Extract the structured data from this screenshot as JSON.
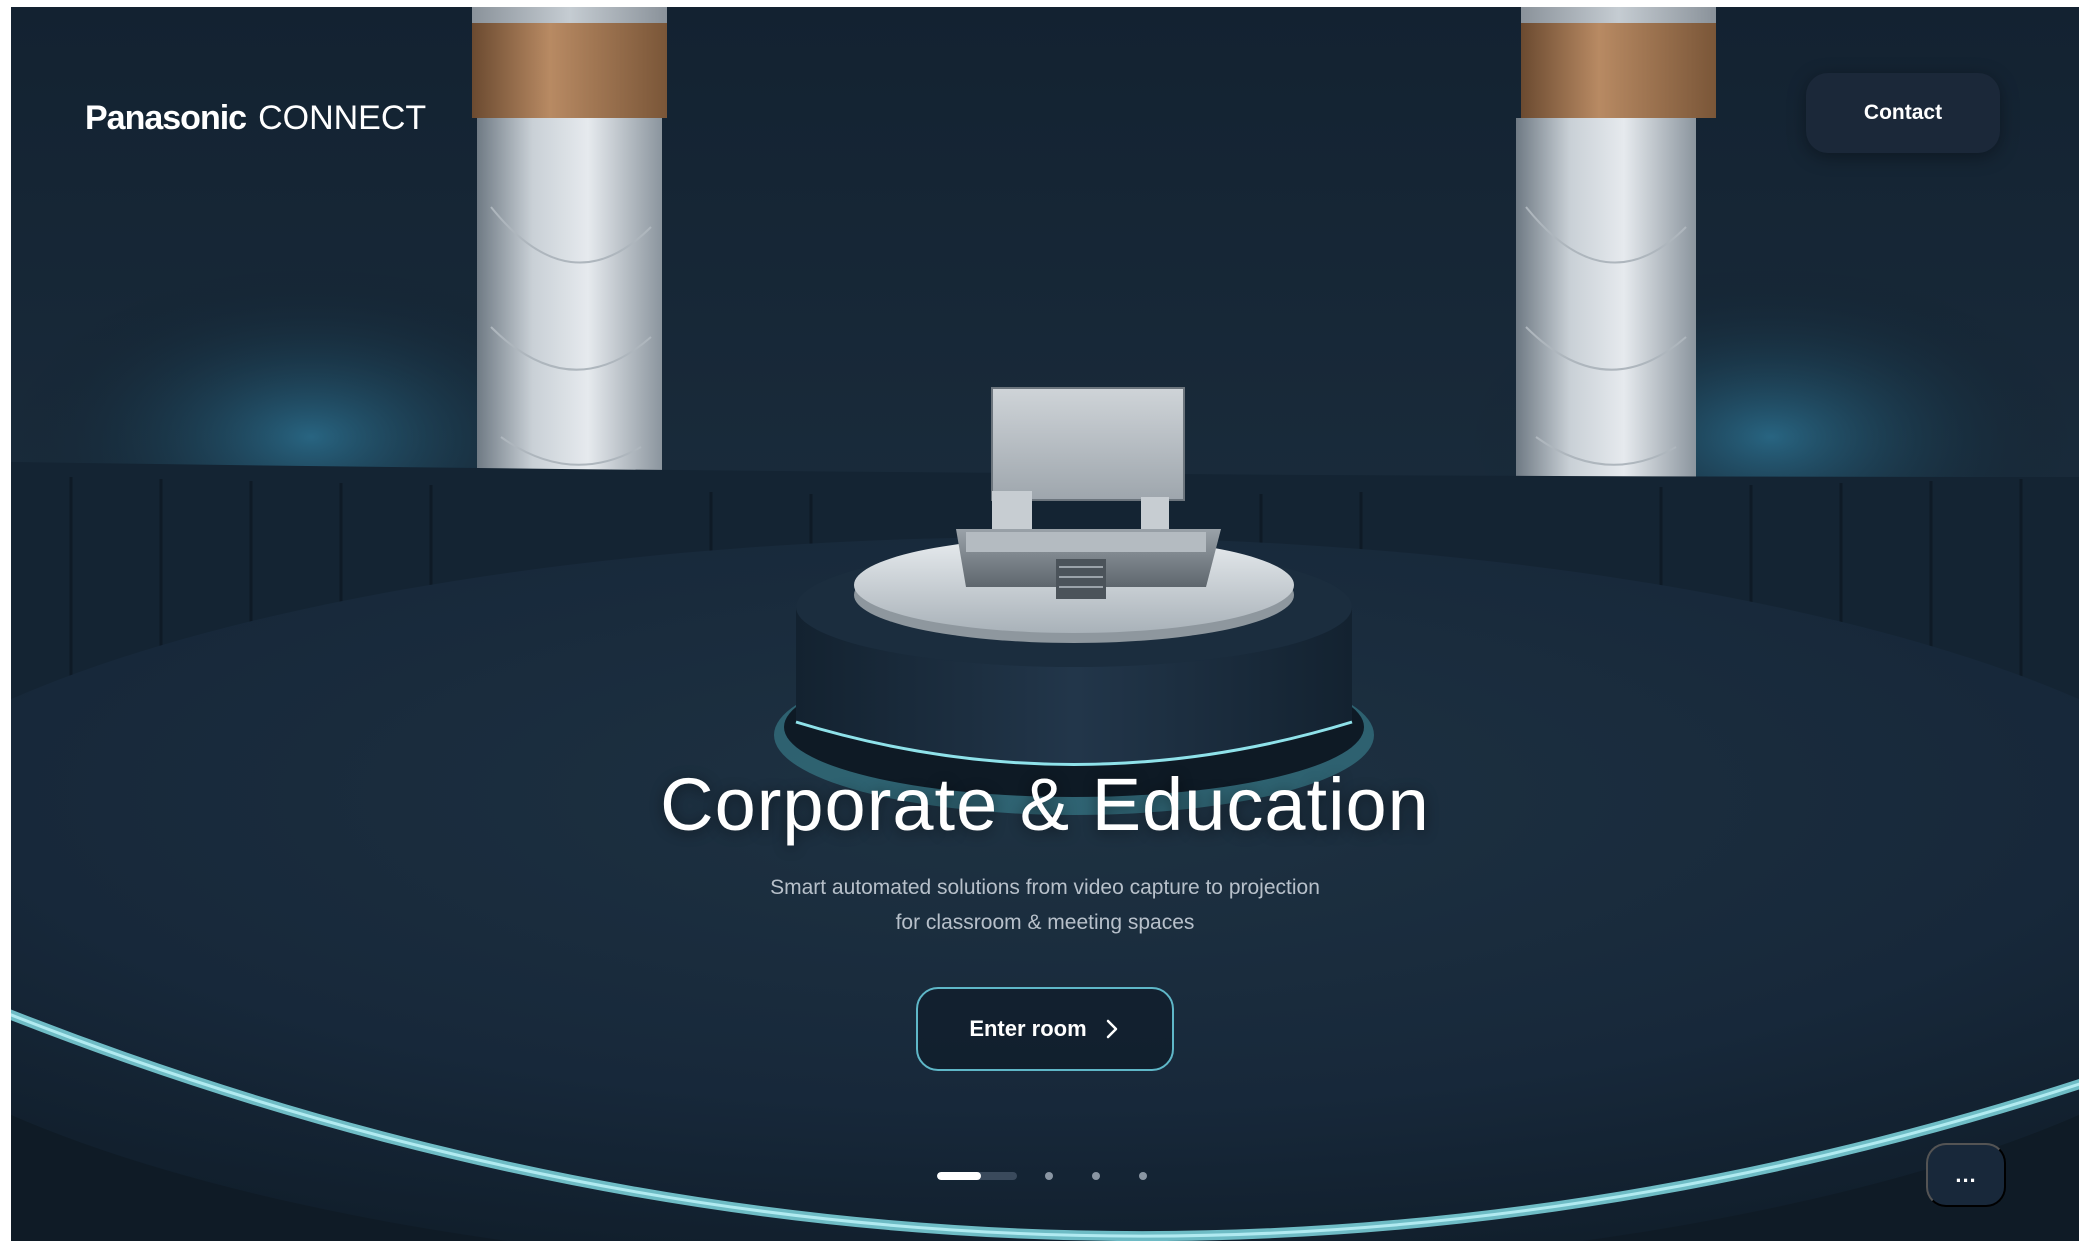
{
  "header": {
    "logo_brand": "Panasonic",
    "logo_product": "CONNECT",
    "contact_label": "Contact"
  },
  "hero": {
    "title": "Corporate & Education",
    "subtitle_line1": "Smart automated solutions from video capture to projection",
    "subtitle_line2": "for classroom & meeting spaces",
    "cta_label": "Enter room"
  },
  "pager": {
    "total": 4,
    "active_index": 0,
    "active_progress": 0.55
  },
  "more_button": {
    "label": "..."
  },
  "colors": {
    "background": "#0f1b26",
    "accent_ring": "#7fd7df",
    "button_dark": "#1b2839",
    "cta_border": "#5fb7c8",
    "subtitle": "#b7c0ca"
  },
  "icons": {
    "cta": "chevron-right-icon",
    "more": "more-dots-icon"
  }
}
